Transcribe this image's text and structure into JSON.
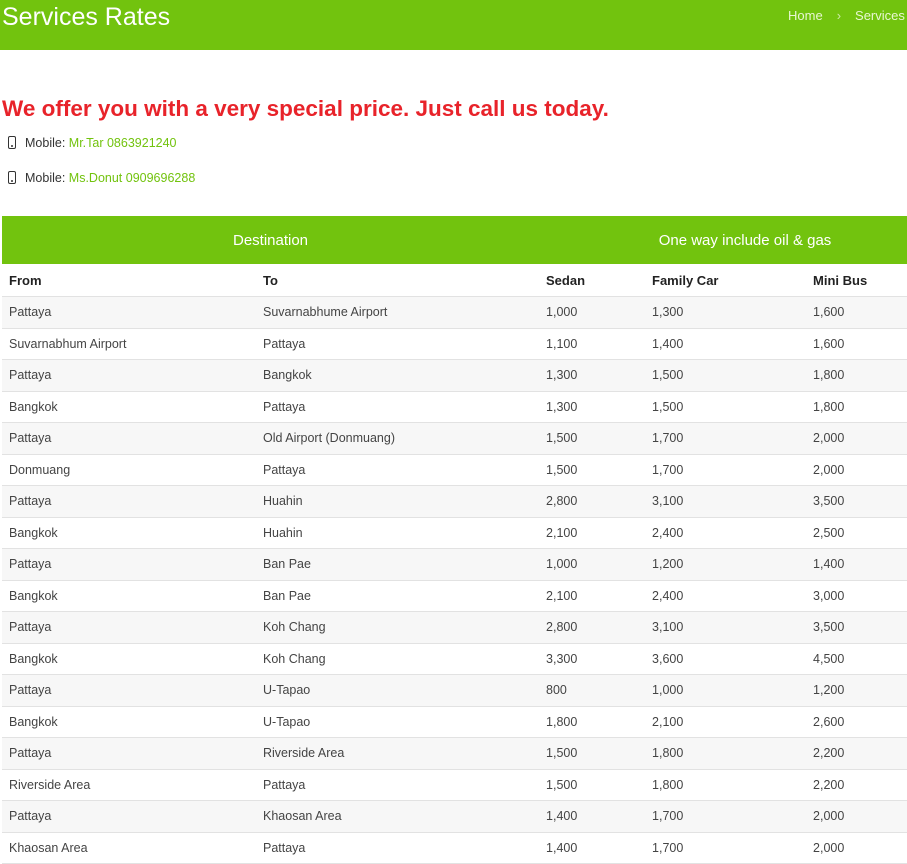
{
  "header": {
    "title": "Services Rates",
    "breadcrumb": {
      "home": "Home",
      "separator": "›",
      "current": "Services"
    }
  },
  "headline": "We offer you with a very special price. Just call us today.",
  "contacts": [
    {
      "label": "Mobile:",
      "value": "Mr.Tar 0863921240",
      "icon": "mobile-phone-icon"
    },
    {
      "label": "Mobile:",
      "value": "Ms.Donut 0909696288",
      "icon": "mobile-phone-icon"
    }
  ],
  "table": {
    "group_headers": {
      "destination": "Destination",
      "prices": "One way include oil & gas"
    },
    "columns": [
      "From",
      "To",
      "Sedan",
      "Family Car",
      "Mini Bus"
    ],
    "rows": [
      [
        "Pattaya",
        "Suvarnabhume Airport",
        "1,000",
        "1,300",
        "1,600"
      ],
      [
        "Suvarnabhum Airport",
        "Pattaya",
        "1,100",
        "1,400",
        "1,600"
      ],
      [
        "Pattaya",
        "Bangkok",
        "1,300",
        "1,500",
        "1,800"
      ],
      [
        "Bangkok",
        "Pattaya",
        "1,300",
        "1,500",
        "1,800"
      ],
      [
        "Pattaya",
        "Old Airport (Donmuang)",
        "1,500",
        "1,700",
        "2,000"
      ],
      [
        "Donmuang",
        "Pattaya",
        "1,500",
        "1,700",
        "2,000"
      ],
      [
        "Pattaya",
        "Huahin",
        "2,800",
        "3,100",
        "3,500"
      ],
      [
        "Bangkok",
        "Huahin",
        "2,100",
        "2,400",
        "2,500"
      ],
      [
        "Pattaya",
        "Ban Pae",
        "1,000",
        "1,200",
        "1,400"
      ],
      [
        "Bangkok",
        "Ban Pae",
        "2,100",
        "2,400",
        "3,000"
      ],
      [
        "Pattaya",
        "Koh Chang",
        "2,800",
        "3,100",
        "3,500"
      ],
      [
        "Bangkok",
        "Koh Chang",
        "3,300",
        "3,600",
        "4,500"
      ],
      [
        "Pattaya",
        "U-Tapao",
        "800",
        "1,000",
        "1,200"
      ],
      [
        "Bangkok",
        "U-Tapao",
        "1,800",
        "2,100",
        "2,600"
      ],
      [
        "Pattaya",
        "Riverside Area",
        "1,500",
        "1,800",
        "2,200"
      ],
      [
        "Riverside Area",
        "Pattaya",
        "1,500",
        "1,800",
        "2,200"
      ],
      [
        "Pattaya",
        "Khaosan Area",
        "1,400",
        "1,700",
        "2,000"
      ],
      [
        "Khaosan Area",
        "Pattaya",
        "1,400",
        "1,700",
        "2,000"
      ]
    ]
  },
  "colors": {
    "brand_green": "#72c30e",
    "headline_red": "#e8232a"
  }
}
